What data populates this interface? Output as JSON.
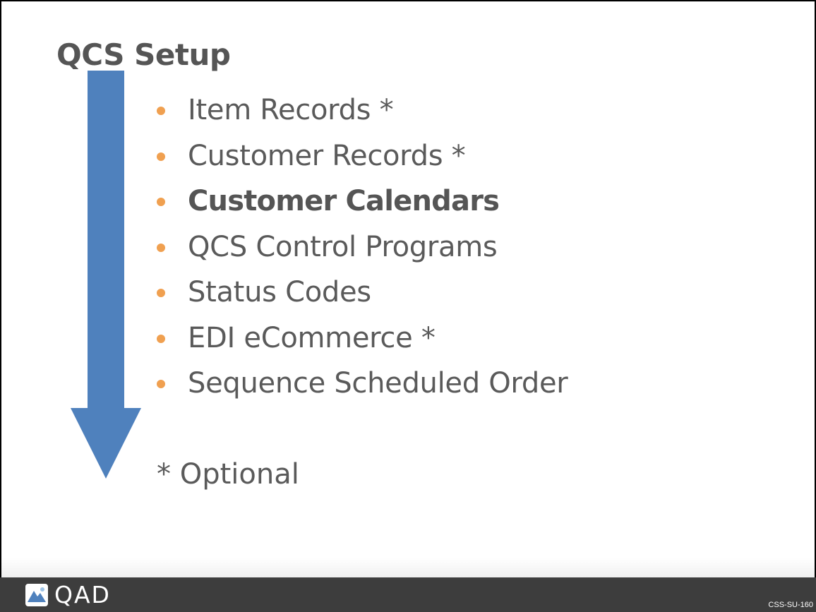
{
  "slide": {
    "title": "QCS Setup",
    "bullets": [
      {
        "label": "Item Records *",
        "bold": false
      },
      {
        "label": "Customer Records *",
        "bold": false
      },
      {
        "label": "Customer Calendars",
        "bold": true
      },
      {
        "label": "QCS Control Programs",
        "bold": false
      },
      {
        "label": "Status Codes",
        "bold": false
      },
      {
        "label": "EDI eCommerce *",
        "bold": false
      },
      {
        "label": "Sequence Scheduled Order",
        "bold": false
      }
    ],
    "note": "* Optional"
  },
  "footer": {
    "logo_text": "QAD",
    "slide_code": "CSS-SU-160"
  },
  "colors": {
    "arrow": "#4f81bd",
    "bullet": "#f0a050",
    "text": "#5a5a5a",
    "footer_bg": "#3d3d3d"
  },
  "icons": {
    "arrow": "down-arrow-icon",
    "logo": "qad-logo-icon"
  }
}
